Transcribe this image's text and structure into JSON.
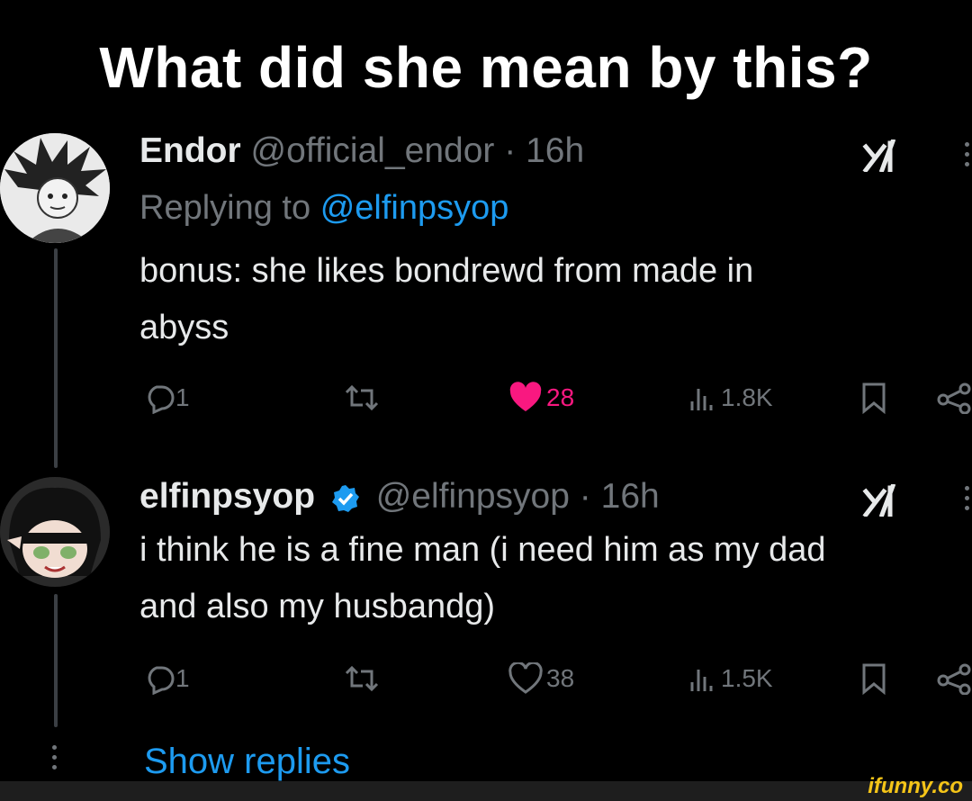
{
  "headline": "What did she mean by this?",
  "tweets": [
    {
      "name": "Endor",
      "handle": "@official_endor",
      "dot": "·",
      "time": "16h",
      "reply_prefix": "Replying to",
      "reply_mention": "@elfinpsyop",
      "text_lines": [
        "bonus: she likes bondrewd from made in",
        "abyss"
      ],
      "replies": "1",
      "likes": "28",
      "views": "1.8K",
      "liked": true
    },
    {
      "name": "elfinpsyop",
      "handle": "@elfinpsyop",
      "dot": "·",
      "time": "16h",
      "text_lines": [
        "i think he is a fine man (i need him as my dad",
        "and also my husbandg)"
      ],
      "replies": "1",
      "likes": "38",
      "views": "1.5K",
      "liked": false
    }
  ],
  "show_replies": "Show replies",
  "watermark": "ifunny.co",
  "colors": {
    "accent": "#1d9bf0",
    "like": "#f91880",
    "muted": "#71767b",
    "text": "#e7e9ea",
    "background": "#000000"
  }
}
